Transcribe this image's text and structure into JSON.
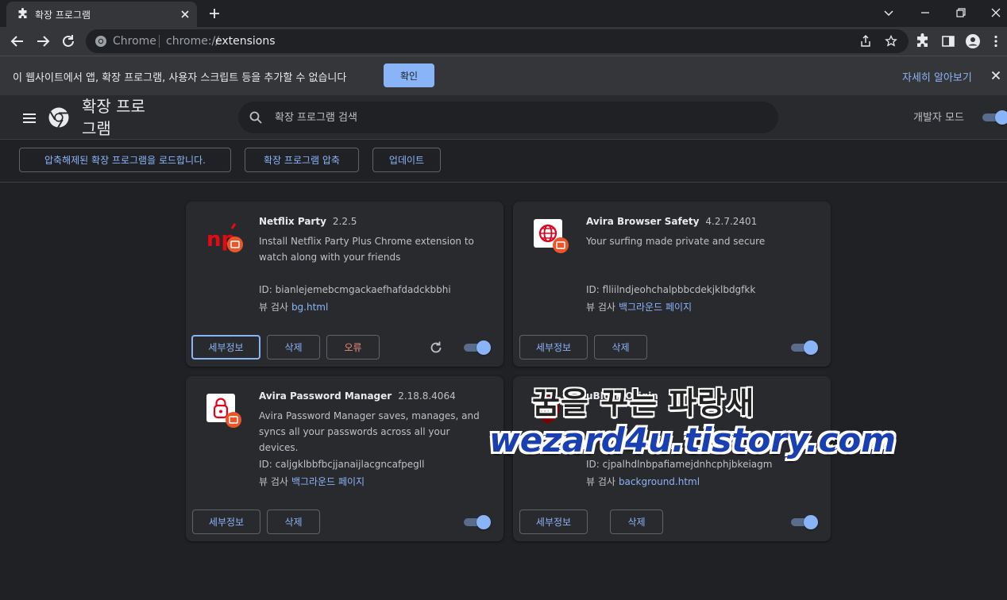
{
  "tab": {
    "title": "확장 프로그램"
  },
  "omnibox": {
    "site_label": "Chrome",
    "url_scheme": "chrome://",
    "url_path": "extensions"
  },
  "infobar": {
    "message": "이 웹사이트에서 앱, 확장 프로그램, 사용자 스크립트 등을 추가할 수 없습니다",
    "confirm_label": "확인",
    "learn_more": "자세히 알아보기"
  },
  "header": {
    "title": "확장 프로그램",
    "search_placeholder": "확장 프로그램 검색",
    "dev_mode_label": "개발자 모드",
    "dev_mode_on": true
  },
  "devbar": {
    "load_unpacked": "압축해제된 확장 프로그램을 로드합니다.",
    "pack": "확장 프로그램 압축",
    "update": "업데이트"
  },
  "labels": {
    "details": "세부정보",
    "remove": "삭제",
    "errors": "오류",
    "inspect_views": "뷰 검사"
  },
  "extensions": [
    {
      "name": "Netflix Party",
      "version": "2.2.5",
      "description": "Install Netflix Party Plus Chrome extension to watch along with your friends",
      "id": "ID: bianlejemebcmgackaefhafdadckbbhi",
      "inspect_link": "bg.html",
      "enabled": true
    },
    {
      "name": "Avira Browser Safety",
      "version": "4.2.7.2401",
      "description": "Your surfing made private and secure",
      "id": "ID: flliilndjeohchalpbbcdekjklbdgfkk",
      "inspect_link": "백그라운드 페이지",
      "enabled": true
    },
    {
      "name": "Avira Password Manager",
      "version": "2.18.8.4064",
      "description": "Avira Password Manager saves, manages, and syncs all your passwords across all your devices.",
      "id": "ID: caljgklbbfbcjjanaijlacgncafpegll",
      "inspect_link": "백그라운드 페이지",
      "enabled": true
    },
    {
      "name": "uBlock Origin",
      "version": "",
      "description": "",
      "id": "ID: cjpalhdlnbpafiamejdnhcphjbkeiagm",
      "inspect_link": "background.html",
      "enabled": true
    }
  ],
  "watermark": {
    "line1": "꿈을 꾸는 파랑새",
    "line2": "wezard4u.tistory.com"
  },
  "colors": {
    "accent": "#8ab4f8",
    "error": "#f28b82",
    "surface": "#292a2d",
    "background": "#202124",
    "badge": "#e8562a",
    "avira_red": "#e3001b"
  }
}
